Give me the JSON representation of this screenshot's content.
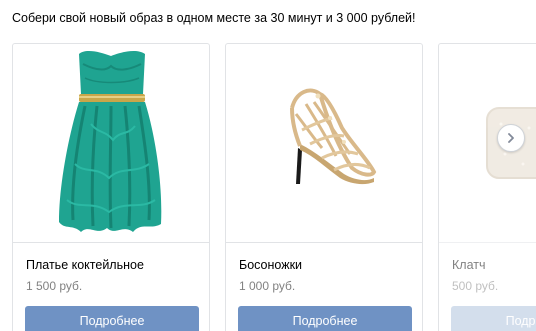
{
  "post": {
    "headline": "Собери свой новый образ в одном месте за 30 минут и 3 000 рублей!"
  },
  "carousel": {
    "items": [
      {
        "title": "Платье коктейльное",
        "price": "1 500 руб.",
        "button_label": "Подробнее",
        "image_icon": "dress-image"
      },
      {
        "title": "Босоножки",
        "price": "1 000 руб.",
        "button_label": "Подробнее",
        "image_icon": "sandals-image"
      },
      {
        "title": "Клатч",
        "price": "500 руб.",
        "button_label": "Подробнее",
        "image_icon": "clutch-image"
      }
    ],
    "next_icon": "chevron-right-icon"
  },
  "colors": {
    "button": "#6f92c4",
    "button_faded": "#a9bedb",
    "price": "#828282",
    "border": "#e1e3e6",
    "dress": "#1fa491",
    "belt": "#c9a64a",
    "sandal": "#d9b98a"
  }
}
